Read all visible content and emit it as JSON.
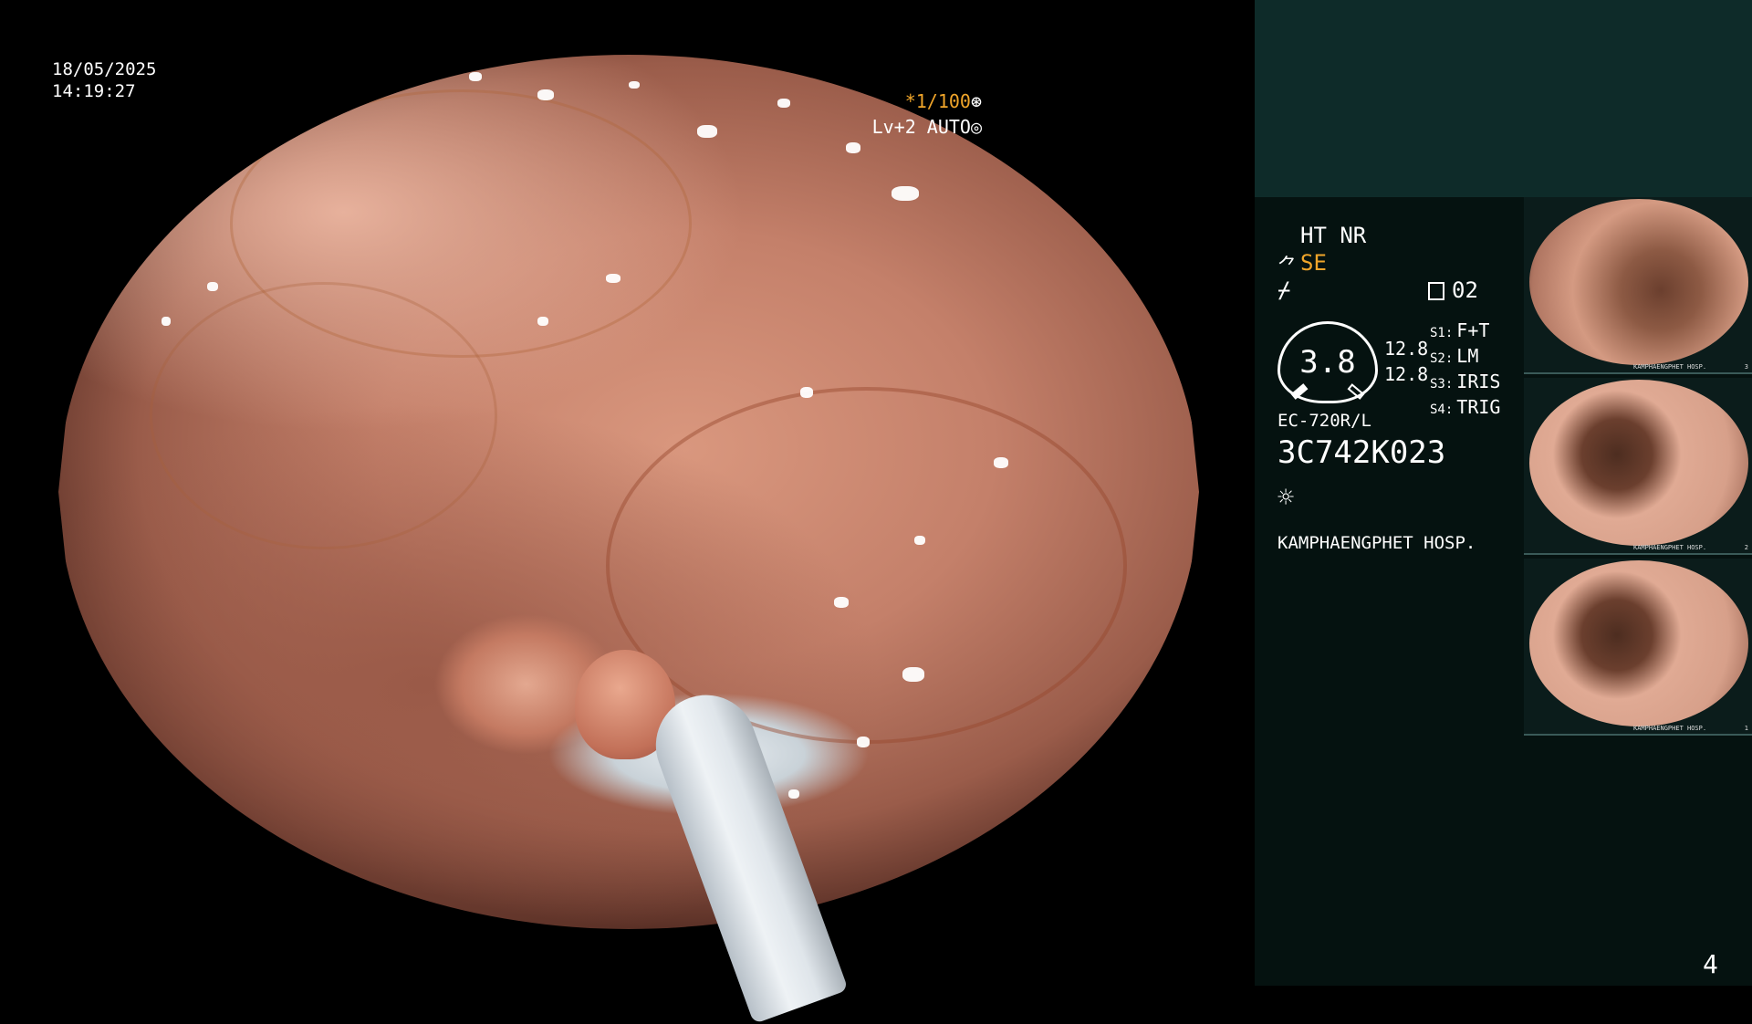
{
  "overlay": {
    "date": "18/05/2025",
    "time": "14:19:27",
    "shutter_speed": "*1/100",
    "shutter_icon": "⊛",
    "iris_mode": "Lv+2 AUTO",
    "iris_icon": "◎"
  },
  "panel": {
    "structure_mode": "HT NR",
    "se_icon": "⺈",
    "se_label": "SE",
    "enhance_icon": "⌿",
    "mode_number": "02",
    "gauge_value": "3.8",
    "value_1": "12.8",
    "value_2": "12.8",
    "slots": [
      {
        "key": "S1:",
        "value": "F+T"
      },
      {
        "key": "S2:",
        "value": "LM"
      },
      {
        "key": "S3:",
        "value": "IRIS"
      },
      {
        "key": "S4:",
        "value": "TRIG"
      }
    ],
    "scope_model": "EC-720R/L",
    "serial": "3C742K023",
    "light_icon": "☼",
    "hospital": "KAMPHAENGPHET HOSP."
  },
  "thumbnails": [
    {
      "caption": "KAMPHAENGPHET HOSP.",
      "index": "3"
    },
    {
      "caption": "KAMPHAENGPHET HOSP.",
      "index": "2"
    },
    {
      "caption": "KAMPHAENGPHET HOSP.",
      "index": "1"
    }
  ],
  "page_number": "4"
}
